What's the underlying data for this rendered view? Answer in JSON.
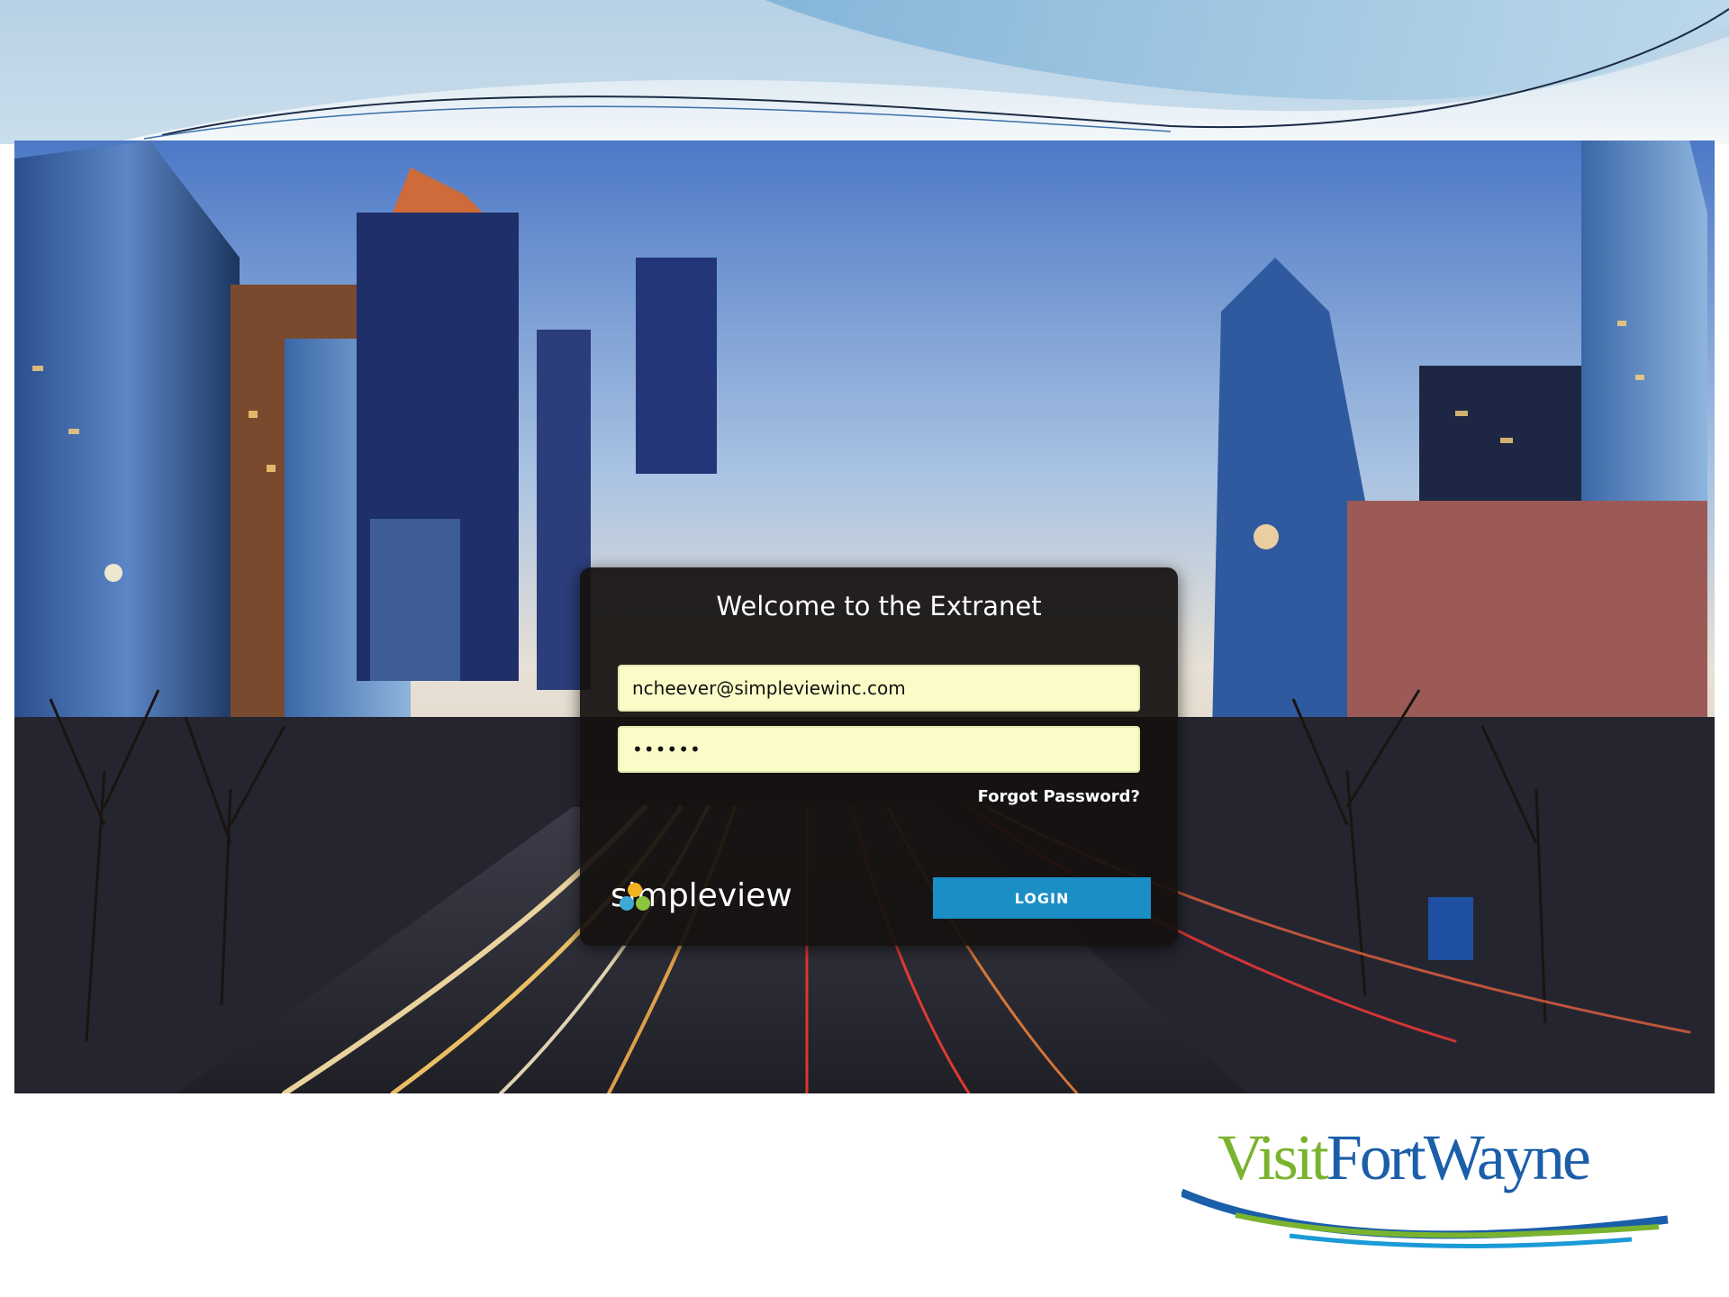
{
  "login": {
    "title": "Welcome to the Extranet",
    "email_value": "ncheever@simpleviewinc.com",
    "password_value": "••••••",
    "forgot_label": "Forgot Password?",
    "login_label": "LOGIN",
    "brand_name": "simpleview"
  },
  "footer_logo": {
    "visit": "Visit",
    "fort_wayne": "FortWayne"
  },
  "colors": {
    "login_button": "#1a8ec5",
    "field_background": "#fbfbc8",
    "visit_green": "#7ab32e",
    "fortwayne_blue": "#1b5ea9"
  }
}
